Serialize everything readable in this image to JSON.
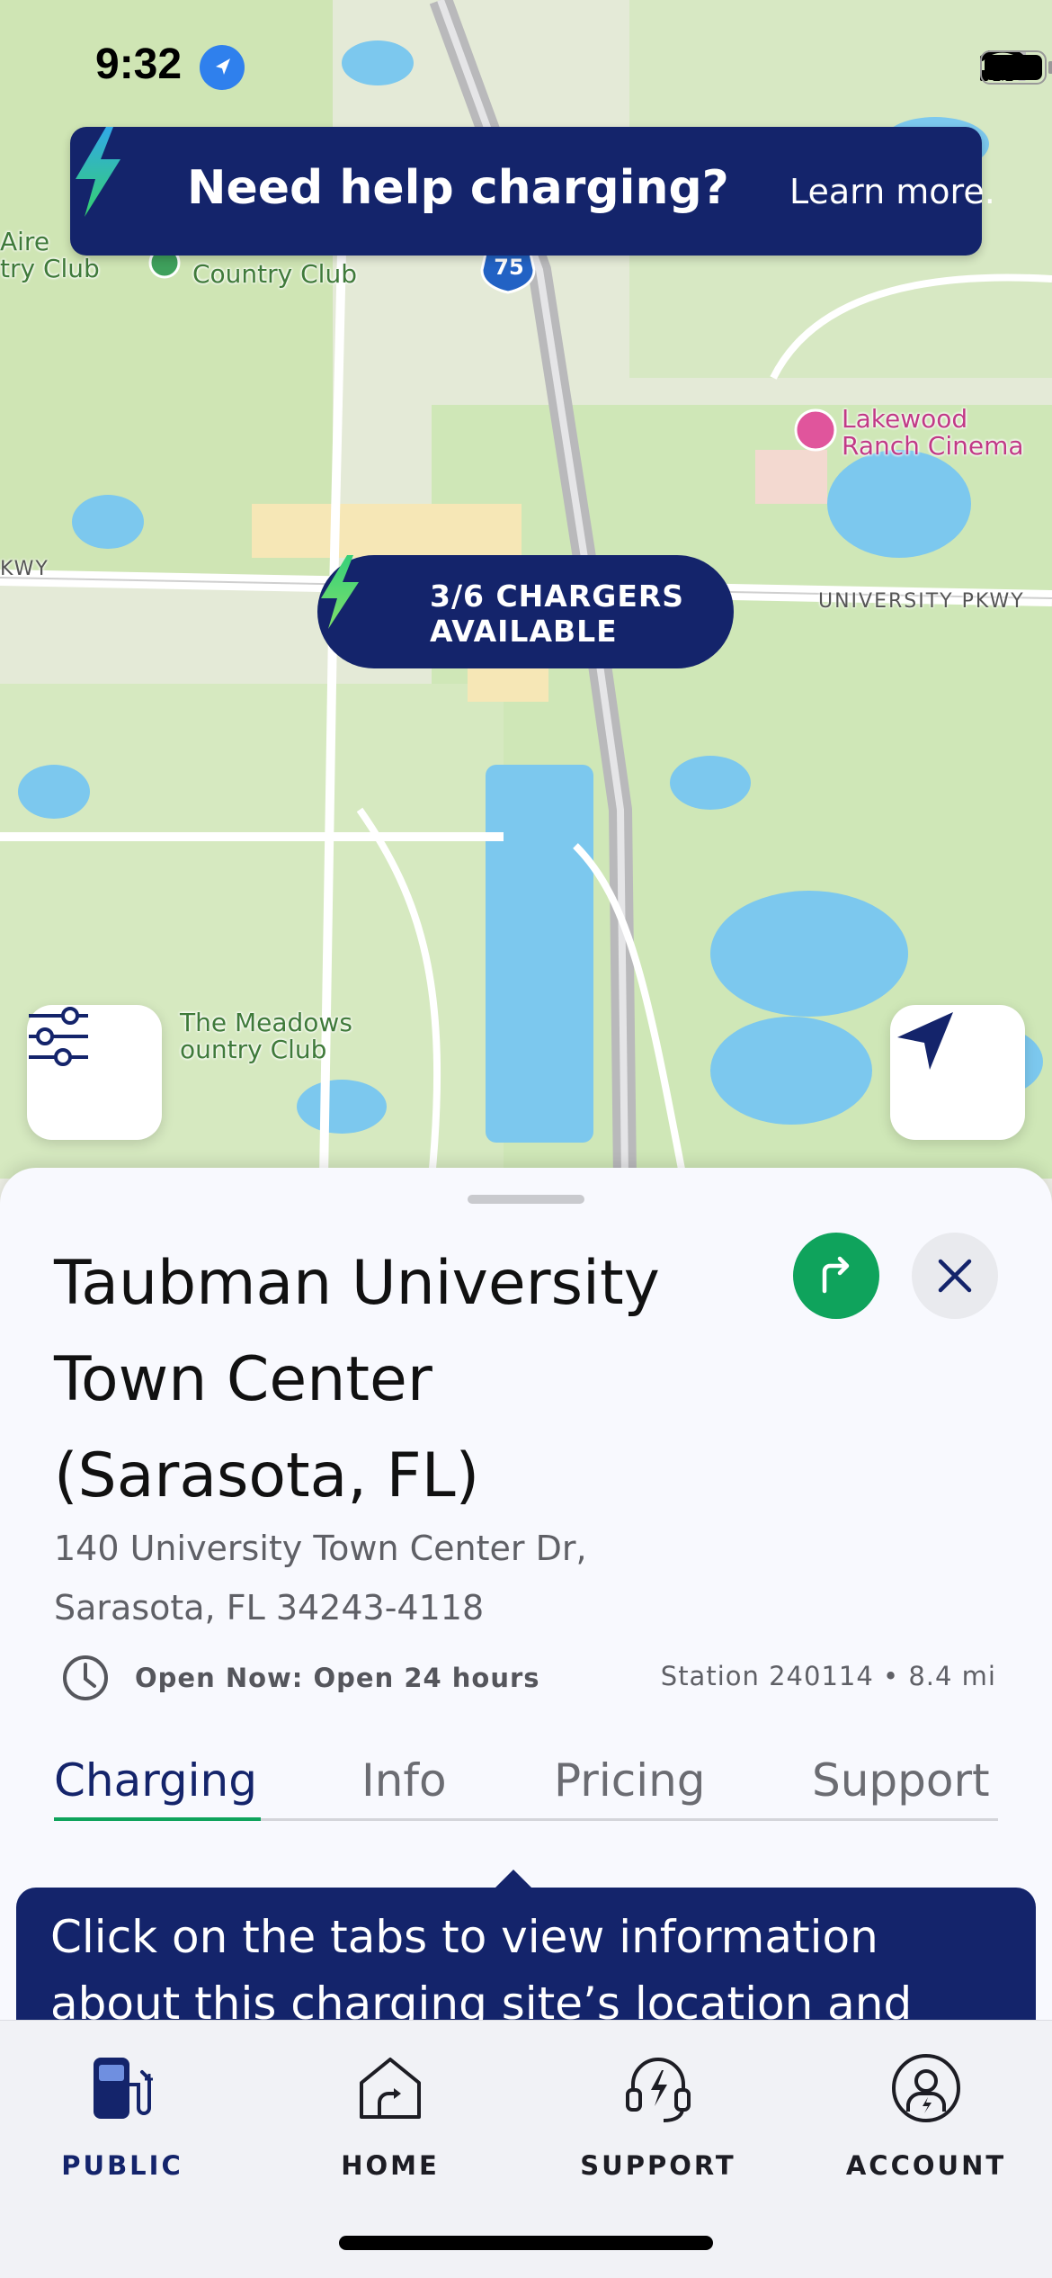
{
  "status_bar": {
    "time": "9:32"
  },
  "help_banner": {
    "title": "Need help charging?",
    "link": "Learn more."
  },
  "map": {
    "labels": {
      "aire_club": "Aire\ntry Club",
      "country_club": "Country Club",
      "highway_shield": "75",
      "lakewood": "Lakewood\nRanch Cinema",
      "pkwy_left": "KWY",
      "university_pkwy": "UNIVERSITY PKWY",
      "meadows": "The Meadows\nountry Club"
    },
    "chargers_pill": "3/6 CHARGERS\nAVAILABLE"
  },
  "site": {
    "name": "Taubman University Town Center (Sarasota, FL)",
    "address_line1": "140 University Town Center Dr,",
    "address_line2": "Sarasota, FL 34243-4118",
    "hours": "Open Now: Open 24 hours",
    "station": "Station 240114 • 8.4 mi"
  },
  "tabs": [
    "Charging",
    "Info",
    "Pricing",
    "Support"
  ],
  "tooltip": "Click on the tabs to view information about this charging site’s location and",
  "tabbar": [
    {
      "label": "PUBLIC",
      "icon": "fuel-pump-icon"
    },
    {
      "label": "HOME",
      "icon": "house-plug-icon"
    },
    {
      "label": "SUPPORT",
      "icon": "headset-bolt-icon"
    },
    {
      "label": "ACCOUNT",
      "icon": "user-circle-icon"
    }
  ],
  "colors": {
    "navy": "#14246b",
    "green": "#0fa35c",
    "bolt_green": "#2fd07a"
  }
}
